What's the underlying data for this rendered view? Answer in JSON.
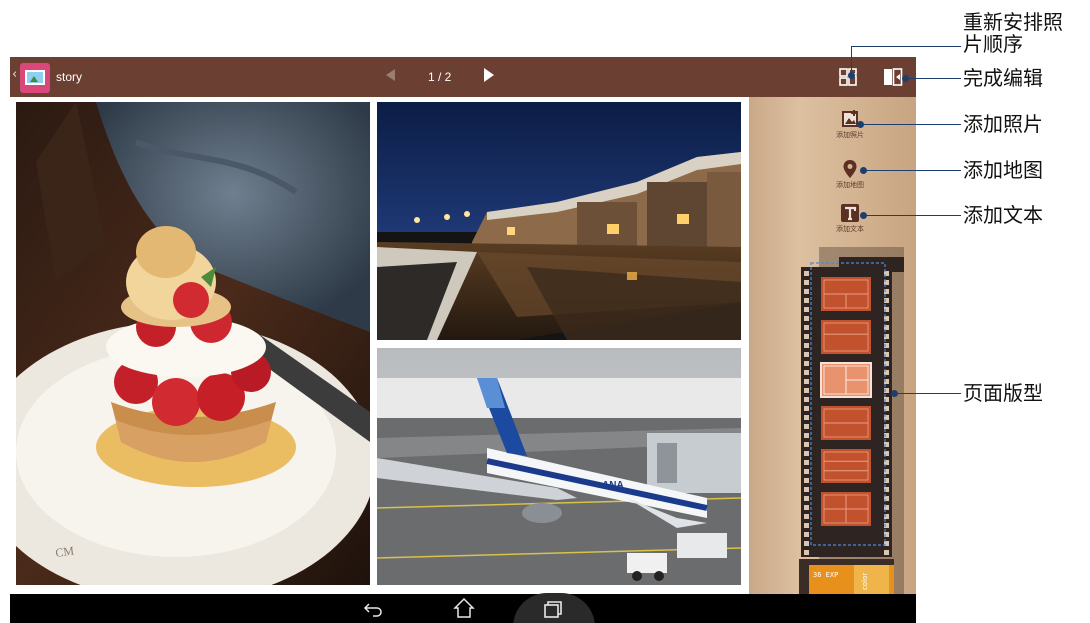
{
  "action_bar": {
    "back_glyph": "‹",
    "app_icon": "story-app-icon",
    "title": "story",
    "page_indicator": "1 / 2",
    "prev_icon": "prev-page-icon",
    "next_icon": "next-page-icon",
    "rearrange_icon": "rearrange-photos-icon",
    "done_icon": "done-editing-icon",
    "color": "#6b3f31"
  },
  "canvas": {
    "photos": [
      {
        "subject": "dessert",
        "icon": "photo-dessert"
      },
      {
        "subject": "canal",
        "icon": "photo-canal"
      },
      {
        "subject": "airplane",
        "icon": "photo-airplane"
      }
    ]
  },
  "side_panel": {
    "tools": [
      {
        "label": "添加照片",
        "icon": "add-photo-icon"
      },
      {
        "label": "添加地图",
        "icon": "map-pin-icon"
      },
      {
        "label": "添加文本",
        "icon": "text-icon"
      }
    ],
    "layouts_count": 6,
    "selected_layout_index": 2,
    "film_text": "36 EXP",
    "film_brand": "color"
  },
  "nav_bar": {
    "back_icon": "nav-back-icon",
    "home_icon": "nav-home-icon",
    "recent_icon": "nav-recent-apps-icon"
  },
  "annotations": [
    {
      "label_line1": "重新安排照",
      "label_line2": "片顺序"
    },
    {
      "label_line1": "完成编辑",
      "label_line2": ""
    },
    {
      "label_line1": "添加照片",
      "label_line2": ""
    },
    {
      "label_line1": "添加地图",
      "label_line2": ""
    },
    {
      "label_line1": "添加文本",
      "label_line2": ""
    },
    {
      "label_line1": "页面版型",
      "label_line2": ""
    }
  ]
}
